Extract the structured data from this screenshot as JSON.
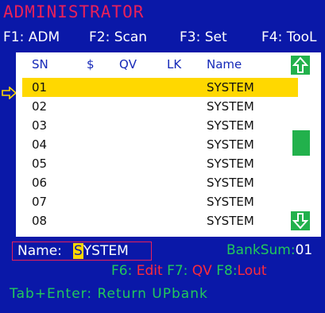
{
  "title": "ADMINISTRATOR",
  "function_keys": [
    {
      "label": "F1: ADM"
    },
    {
      "label": "F2: Scan"
    },
    {
      "label": "F3: Set"
    },
    {
      "label": "F4: TooL"
    }
  ],
  "table": {
    "headers": {
      "sn": "SN",
      "dollar": "$",
      "qv": "QV",
      "lk": "LK",
      "name": "Name"
    },
    "rows": [
      {
        "sn": "01",
        "name": "SYSTEM"
      },
      {
        "sn": "02",
        "name": "SYSTEM"
      },
      {
        "sn": "03",
        "name": "SYSTEM"
      },
      {
        "sn": "04",
        "name": "SYSTEM"
      },
      {
        "sn": "05",
        "name": "SYSTEM"
      },
      {
        "sn": "06",
        "name": "SYSTEM"
      },
      {
        "sn": "07",
        "name": "SYSTEM"
      },
      {
        "sn": "08",
        "name": "SYSTEM"
      }
    ],
    "selected_index": 0
  },
  "name_field": {
    "label": "Name:",
    "cursor_char": "S",
    "rest": "YSTEM"
  },
  "bank_sum": {
    "label": "BankSum:",
    "value": "01"
  },
  "edit_keys": {
    "f6_key": "F6:",
    "f6_action": "Edit",
    "f7_key": "F7:",
    "f7_action": "QV",
    "f8_key": "F8:",
    "f8_action": "Lout"
  },
  "return_hint": "Tab+Enter: Return UPbank",
  "icons": {
    "scroll_up": "arrow-up-icon",
    "scroll_down": "arrow-down-icon",
    "row_pointer": "arrow-right-icon"
  },
  "colors": {
    "background": "#0a18a8",
    "title": "#e8205a",
    "selection": "#ffd800",
    "scroll": "#22b14c",
    "hint_green": "#22c95a",
    "action_red": "#ff2b3a"
  }
}
